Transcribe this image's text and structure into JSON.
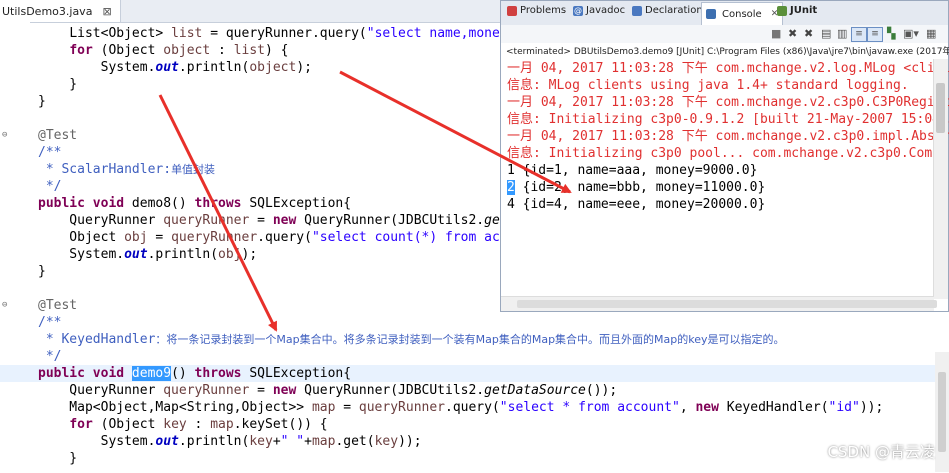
{
  "editor": {
    "tab_label": "UtilsDemo3.java",
    "lines": [
      {
        "t": "    List<Object> list = queryRunner.query(\"select name,money"
      },
      {
        "t": "    for (Object object : list) {"
      },
      {
        "t": "        System.out.println(object);"
      },
      {
        "t": "    }"
      },
      {
        "t": "}"
      },
      {
        "t": ""
      },
      {
        "t": "@Test"
      },
      {
        "t": "/**"
      },
      {
        "t": " * ScalarHandler:单值封装"
      },
      {
        "t": " */"
      },
      {
        "t": "public void demo8() throws SQLException{"
      },
      {
        "t": "    QueryRunner queryRunner = new QueryRunner(JDBCUtils2.get"
      },
      {
        "t": "    Object obj = queryRunner.query(\"select count(*) from acc"
      },
      {
        "t": "    System.out.println(obj);"
      },
      {
        "t": "}"
      },
      {
        "t": ""
      },
      {
        "t": "@Test"
      },
      {
        "t": "/**"
      },
      {
        "t": " * KeyedHandler：将一条记录封装到一个Map集合中。将多条记录封装到一个装有Map集合的Map集合中。而且外面的Map的key是可以指定的。"
      },
      {
        "t": " */"
      },
      {
        "t": "public void demo9() throws SQLException{"
      },
      {
        "t": "    QueryRunner queryRunner = new QueryRunner(JDBCUtils2.getDataSource());"
      },
      {
        "t": "    Map<Object,Map<String,Object>> map = queryRunner.query(\"select * from account\", new KeyedHandler(\"id\"));"
      },
      {
        "t": "    for (Object key : map.keySet()) {"
      },
      {
        "t": "        System.out.println(key+\" \"+map.get(key));"
      },
      {
        "t": "    }"
      }
    ]
  },
  "console": {
    "tabs": [
      {
        "label": "Problems",
        "color": "#d04040"
      },
      {
        "label": "Javadoc",
        "color": "#4a78c0"
      },
      {
        "label": "Declaration",
        "color": "#4a78c0"
      },
      {
        "label": "Console",
        "color": "#3d6fb0"
      },
      {
        "label": "JUnit",
        "color": "#5a8f3a"
      }
    ],
    "close_label": "✕",
    "terminated": "<terminated> DBUtilsDemo3.demo9 [JUnit] C:\\Program Files (x86)\\Java\\jre7\\bin\\javaw.exe (2017年1",
    "lines": [
      {
        "text": "一月 04, 2017 11:03:28 下午 com.mchange.v2.log.MLog <clinit>",
        "cls": "red"
      },
      {
        "text": "信息: MLog clients using java 1.4+ standard logging.",
        "cls": "red"
      },
      {
        "text": "一月 04, 2017 11:03:28 下午 com.mchange.v2.c3p0.C3P0Registry",
        "cls": "red"
      },
      {
        "text": "信息: Initializing c3p0-0.9.1.2 [built 21-May-2007 15:04:5",
        "cls": "red"
      },
      {
        "text": "一月 04, 2017 11:03:28 下午 com.mchange.v2.c3p0.impl.Abstract",
        "cls": "red"
      },
      {
        "text": "信息: Initializing c3p0 pool... com.mchange.v2.c3p0.ComboP",
        "cls": "red"
      },
      {
        "text": "1 {id=1, name=aaa, money=9000.0}",
        "cls": "blk"
      },
      {
        "text": "2 {id=2, name=bbb, money=11000.0}",
        "cls": "blk"
      },
      {
        "text": "4 {id=4, name=eee, money=20000.0}",
        "cls": "blk"
      }
    ]
  },
  "watermark": "CSDN @青云凌"
}
